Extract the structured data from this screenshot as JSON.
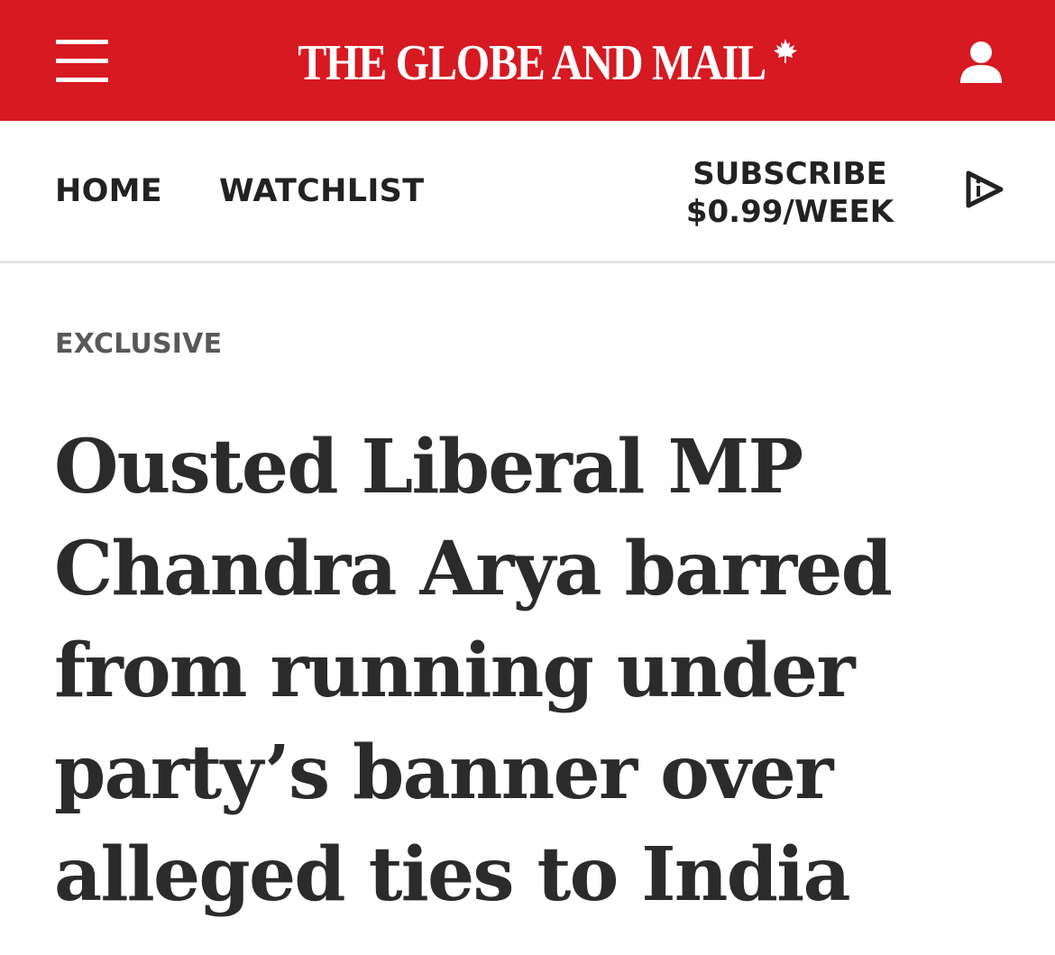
{
  "header": {
    "brand": "THE GLOBE AND MAIL",
    "brand_color": "#d71921",
    "menu_icon": "hamburger-menu-icon",
    "logo_icon": "maple-leaf-icon",
    "account_icon": "user-account-icon"
  },
  "nav": {
    "home_label": "HOME",
    "watchlist_label": "WATCHLIST",
    "subscribe_line1": "SUBSCRIBE",
    "subscribe_line2": "$0.99/WEEK",
    "audio_icon": "play-audio-icon"
  },
  "article": {
    "kicker": "EXCLUSIVE",
    "headline_lines": [
      "Ousted Liberal MP",
      "Chandra Arya barred",
      "from running under",
      "party’s banner over",
      "alleged ties to India"
    ]
  }
}
